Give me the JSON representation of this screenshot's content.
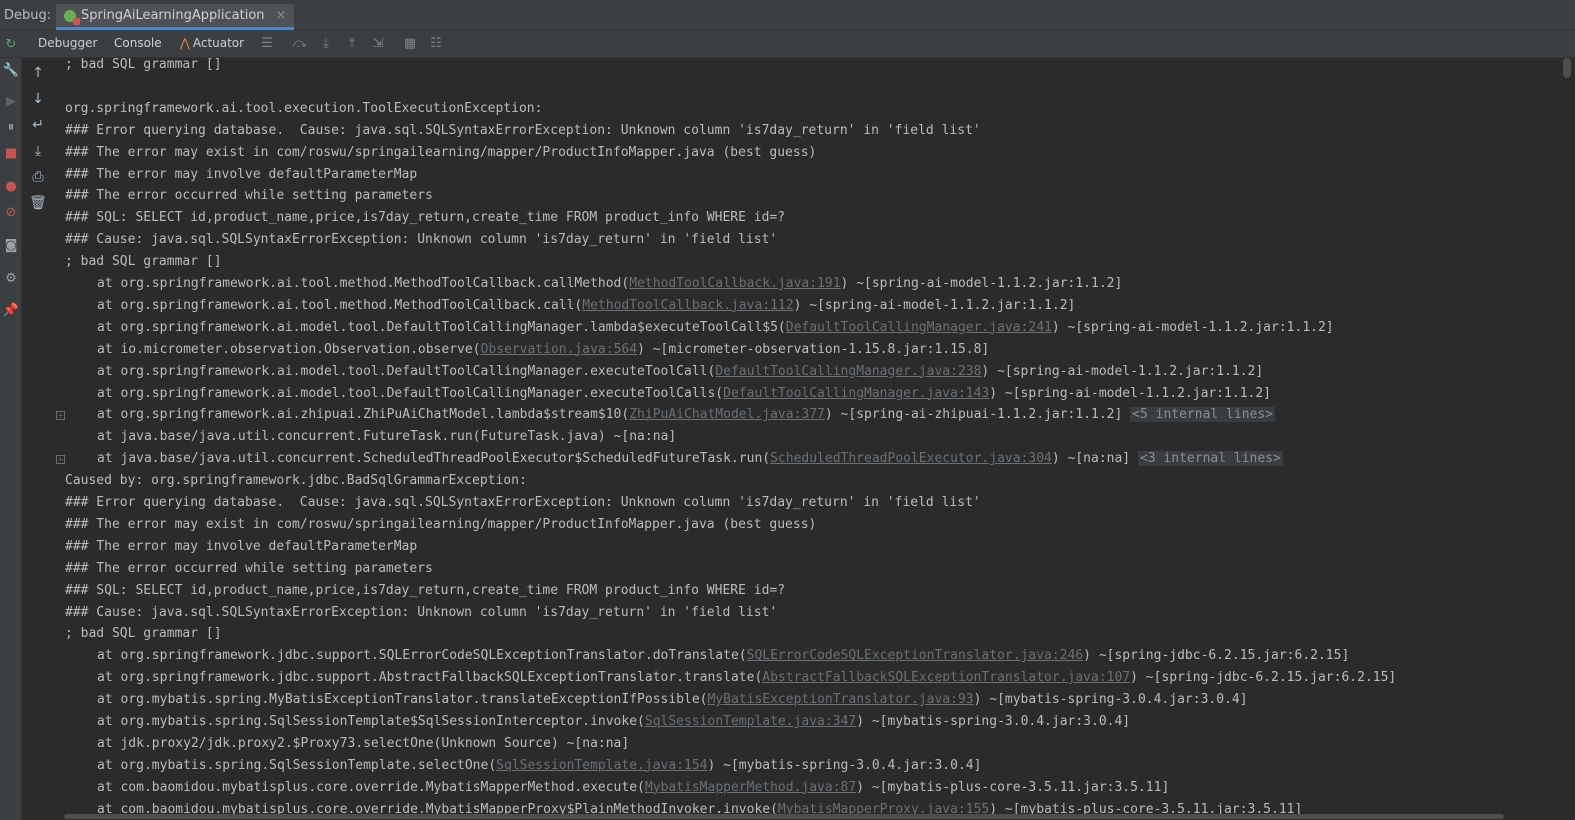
{
  "titlebar": {
    "debug_label": "Debug:",
    "run_config": "SpringAiLearningApplication",
    "close_glyph": "×"
  },
  "toolbar": {
    "tabs": [
      "Debugger",
      "Console",
      "Actuator"
    ],
    "icons": [
      "layout-icon",
      "step-over-icon",
      "step-into-icon",
      "step-out-icon",
      "run-to-cursor-icon",
      "evaluate-icon",
      "trace-icon"
    ]
  },
  "left_rail_icons": [
    "rerun-icon",
    "wrench-icon",
    "resume-icon",
    "pause-icon",
    "stop-icon",
    "view-breakpoints-icon",
    "mute-breakpoints-icon",
    "camera-icon",
    "settings-icon",
    "pin-icon"
  ],
  "console_rail_icons": [
    "up-arrow-icon",
    "down-arrow-icon",
    "soft-wrap-icon",
    "scroll-to-end-icon",
    "print-icon",
    "clear-icon"
  ],
  "colors": {
    "background": "#2b2b2b",
    "text": "#bbbbbb",
    "link": "#6b7075",
    "accent": "#4a88c7"
  },
  "console": {
    "lines": [
      {
        "text": "; bad SQL grammar []"
      },
      {
        "text": ""
      },
      {
        "text": "org.springframework.ai.tool.execution.ToolExecutionException: "
      },
      {
        "text": "### Error querying database.  Cause: java.sql.SQLSyntaxErrorException: Unknown column 'is7day_return' in 'field list'"
      },
      {
        "text": "### The error may exist in com/roswu/springailearning/mapper/ProductInfoMapper.java (best guess)"
      },
      {
        "text": "### The error may involve defaultParameterMap"
      },
      {
        "text": "### The error occurred while setting parameters"
      },
      {
        "text": "### SQL: SELECT id,product_name,price,is7day_return,create_time FROM product_info WHERE id=?"
      },
      {
        "text": "### Cause: java.sql.SQLSyntaxErrorException: Unknown column 'is7day_return' in 'field list'"
      },
      {
        "text": "; bad SQL grammar []"
      },
      {
        "indent": true,
        "pre": "at org.springframework.ai.tool.method.MethodToolCallback.callMethod(",
        "link": "MethodToolCallback.java:191",
        "post": ") ~[spring-ai-model-1.1.2.jar:1.1.2]"
      },
      {
        "indent": true,
        "pre": "at org.springframework.ai.tool.method.MethodToolCallback.call(",
        "link": "MethodToolCallback.java:112",
        "post": ") ~[spring-ai-model-1.1.2.jar:1.1.2]"
      },
      {
        "indent": true,
        "pre": "at org.springframework.ai.model.tool.DefaultToolCallingManager.lambda$executeToolCall$5(",
        "link": "DefaultToolCallingManager.java:241",
        "post": ") ~[spring-ai-model-1.1.2.jar:1.1.2]"
      },
      {
        "indent": true,
        "pre": "at io.micrometer.observation.Observation.observe(",
        "link": "Observation.java:564",
        "post": ") ~[micrometer-observation-1.15.8.jar:1.15.8]"
      },
      {
        "indent": true,
        "pre": "at org.springframework.ai.model.tool.DefaultToolCallingManager.executeToolCall(",
        "link": "DefaultToolCallingManager.java:238",
        "post": ") ~[spring-ai-model-1.1.2.jar:1.1.2]"
      },
      {
        "indent": true,
        "pre": "at org.springframework.ai.model.tool.DefaultToolCallingManager.executeToolCalls(",
        "link": "DefaultToolCallingManager.java:143",
        "post": ") ~[spring-ai-model-1.1.2.jar:1.1.2]"
      },
      {
        "indent": true,
        "fold": true,
        "pre": "at org.springframework.ai.zhipuai.ZhiPuAiChatModel.lambda$stream$10(",
        "link": "ZhiPuAiChatModel.java:377",
        "post": ") ~[spring-ai-zhipuai-1.1.2.jar:1.1.2] ",
        "internal": "<5 internal lines>"
      },
      {
        "indent": true,
        "pre": "at java.base/java.util.concurrent.FutureTask.run(FutureTask.java) ~[na:na]"
      },
      {
        "indent": true,
        "fold": true,
        "pre": "at java.base/java.util.concurrent.ScheduledThreadPoolExecutor$ScheduledFutureTask.run(",
        "link": "ScheduledThreadPoolExecutor.java:304",
        "post": ") ~[na:na] ",
        "internal": "<3 internal lines>"
      },
      {
        "text": "Caused by: org.springframework.jdbc.BadSqlGrammarException: "
      },
      {
        "text": "### Error querying database.  Cause: java.sql.SQLSyntaxErrorException: Unknown column 'is7day_return' in 'field list'"
      },
      {
        "text": "### The error may exist in com/roswu/springailearning/mapper/ProductInfoMapper.java (best guess)"
      },
      {
        "text": "### The error may involve defaultParameterMap"
      },
      {
        "text": "### The error occurred while setting parameters"
      },
      {
        "text": "### SQL: SELECT id,product_name,price,is7day_return,create_time FROM product_info WHERE id=?"
      },
      {
        "text": "### Cause: java.sql.SQLSyntaxErrorException: Unknown column 'is7day_return' in 'field list'"
      },
      {
        "text": "; bad SQL grammar []"
      },
      {
        "indent": true,
        "pre": "at org.springframework.jdbc.support.SQLErrorCodeSQLExceptionTranslator.doTranslate(",
        "link": "SQLErrorCodeSQLExceptionTranslator.java:246",
        "post": ") ~[spring-jdbc-6.2.15.jar:6.2.15]"
      },
      {
        "indent": true,
        "pre": "at org.springframework.jdbc.support.AbstractFallbackSQLExceptionTranslator.translate(",
        "link": "AbstractFallbackSQLExceptionTranslator.java:107",
        "post": ") ~[spring-jdbc-6.2.15.jar:6.2.15]"
      },
      {
        "indent": true,
        "pre": "at org.mybatis.spring.MyBatisExceptionTranslator.translateExceptionIfPossible(",
        "link": "MyBatisExceptionTranslator.java:93",
        "post": ") ~[mybatis-spring-3.0.4.jar:3.0.4]"
      },
      {
        "indent": true,
        "pre": "at org.mybatis.spring.SqlSessionTemplate$SqlSessionInterceptor.invoke(",
        "link": "SqlSessionTemplate.java:347",
        "post": ") ~[mybatis-spring-3.0.4.jar:3.0.4]"
      },
      {
        "indent": true,
        "pre": "at jdk.proxy2/jdk.proxy2.$Proxy73.selectOne(Unknown Source) ~[na:na]"
      },
      {
        "indent": true,
        "pre": "at org.mybatis.spring.SqlSessionTemplate.selectOne(",
        "link": "SqlSessionTemplate.java:154",
        "post": ") ~[mybatis-spring-3.0.4.jar:3.0.4]"
      },
      {
        "indent": true,
        "pre": "at com.baomidou.mybatisplus.core.override.MybatisMapperMethod.execute(",
        "link": "MybatisMapperMethod.java:87",
        "post": ") ~[mybatis-plus-core-3.5.11.jar:3.5.11]"
      },
      {
        "indent": true,
        "pre": "at com.baomidou.mybatisplus.core.override.MybatisMapperProxy$PlainMethodInvoker.invoke(",
        "link": "MybatisMapperProxy.java:155",
        "post": ") ~[mybatis-plus-core-3.5.11.jar:3.5.11]"
      }
    ]
  }
}
